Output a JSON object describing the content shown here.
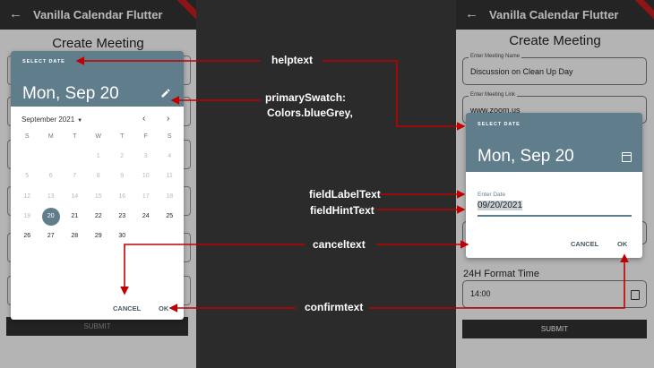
{
  "app": {
    "title": "Vanilla Calendar Flutter",
    "back_icon": "back-arrow-icon"
  },
  "left_screen": {
    "page_title": "Create Meeting",
    "submit_label": "SUBMIT",
    "dialog": {
      "help_text": "SELECT DATE",
      "header_date": "Mon, Sep 20",
      "header_color": "#607d8b",
      "month_label": "September 2021",
      "weekdays": [
        "S",
        "M",
        "T",
        "W",
        "T",
        "F",
        "S"
      ],
      "weeks": [
        [
          "",
          "",
          "",
          "1",
          "2",
          "3",
          "4"
        ],
        [
          "5",
          "6",
          "7",
          "8",
          "9",
          "10",
          "11"
        ],
        [
          "12",
          "13",
          "14",
          "15",
          "16",
          "17",
          "18"
        ],
        [
          "19",
          "20",
          "21",
          "22",
          "23",
          "24",
          "25"
        ],
        [
          "26",
          "27",
          "28",
          "29",
          "30",
          "",
          ""
        ]
      ],
      "selected_day": "20",
      "cancel_label": "CANCEL",
      "ok_label": "OK"
    }
  },
  "right_screen": {
    "page_title": "Create Meeting",
    "meeting_name_label": "Enter Meeting Name",
    "meeting_name_value": "Discussion on Clean Up Day",
    "meeting_link_label": "Enter Meeting Link",
    "meeting_link_value": "www.zoom.us",
    "format_label": "24H Format Time",
    "time_value": "14:00",
    "submit_label": "SUBMIT",
    "dialog": {
      "help_text": "SELECT DATE",
      "header_date": "Mon, Sep 20",
      "field_label": "Enter Date",
      "field_value": "09/20/2021",
      "cancel_label": "CANCEL",
      "ok_label": "OK"
    }
  },
  "annotations": {
    "helptext": "helptext",
    "primary_swatch_line1": "primarySwatch:",
    "primary_swatch_line2": "Colors.blueGrey,",
    "field_label_text": "fieldLabelText",
    "field_hint_text": "fieldHintText",
    "cancel_text": "canceltext",
    "confirm_text": "confirmtext",
    "arrow_color": "#c00000"
  }
}
